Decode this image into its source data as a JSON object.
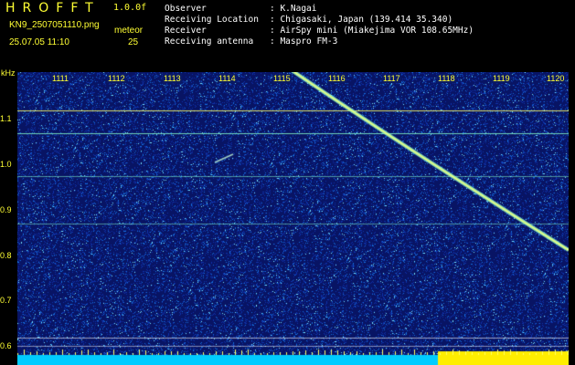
{
  "header": {
    "logo": "HROFFT",
    "version": "1.0.0f",
    "filename": "KN9_2507051110.png",
    "meteor_label": "meteor",
    "timestamp": "25.07.05 11:10",
    "meteor_count": "25"
  },
  "info": [
    {
      "label": "Observer",
      "value": ": K.Nagai"
    },
    {
      "label": "Receiving Location",
      "value": ": Chigasaki, Japan (139.414 35.340)"
    },
    {
      "label": "Receiver",
      "value": ": AirSpy mini (Miakejima VOR 108.65MHz)"
    },
    {
      "label": "Receiving antenna",
      "value": ": Maspro FM-3"
    }
  ],
  "y_axis": {
    "unit": "kHz",
    "ticks": [
      "1.1",
      "1.0",
      "0.9",
      "0.8",
      "0.7",
      "0.6"
    ]
  },
  "x_axis": {
    "ticks": [
      "1111",
      "1112",
      "1113",
      "1114",
      "1115",
      "1116",
      "1117",
      "1118",
      "1119",
      "1120"
    ]
  },
  "colors": {
    "background": "#000000",
    "label": "#ffff33",
    "noise_bg": "#0a1a66",
    "signal": "#66ffcc",
    "strip": "#00ccff"
  }
}
